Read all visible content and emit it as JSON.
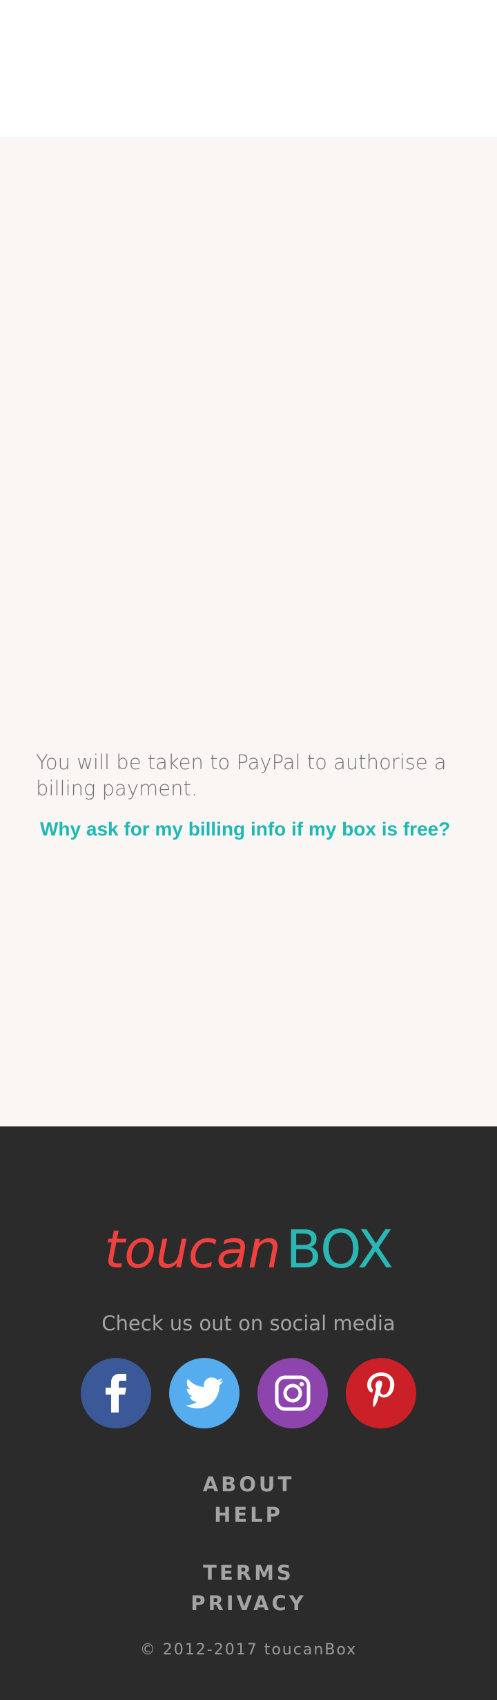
{
  "main": {
    "paypal_note": "You will be taken to PayPal to authorise a billing payment.",
    "billing_link": "Why ask for my billing info if my box is free?"
  },
  "footer": {
    "logo": {
      "part1": "toucan",
      "part2": "BOX"
    },
    "social_heading": "Check us out on social media",
    "social": [
      {
        "icon": "facebook-icon",
        "color": "#3b5998"
      },
      {
        "icon": "twitter-icon",
        "color": "#55acee"
      },
      {
        "icon": "instagram-icon",
        "color": "#8e44ad"
      },
      {
        "icon": "pinterest-icon",
        "color": "#cb2027"
      }
    ],
    "links_group1": [
      "ABOUT",
      "HELP"
    ],
    "links_group2": [
      "TERMS",
      "PRIVACY"
    ],
    "copyright": "© 2012-2017 toucanBox"
  }
}
